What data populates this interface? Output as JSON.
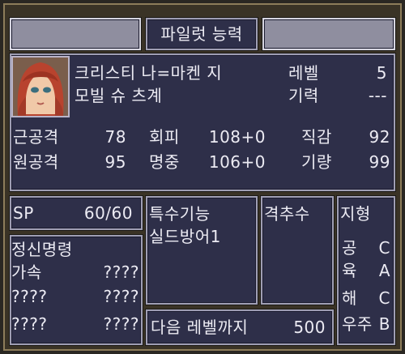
{
  "header": {
    "title": "파일럿 능력"
  },
  "pilot": {
    "name": "크리스티 나=마켄 지",
    "unit": "모빌 슈 츠계",
    "level_label": "레벨",
    "level_value": "5",
    "energy_label": "기력",
    "energy_value": "---"
  },
  "stats": {
    "melee_label": "근공격",
    "melee_value": "78",
    "ranged_label": "원공격",
    "ranged_value": "95",
    "evasion_label": "회피",
    "evasion_value": "108+0",
    "accuracy_label": "명중",
    "accuracy_value": "106+0",
    "intuition_label": "직감",
    "intuition_value": "92",
    "skill_label": "기량",
    "skill_value": "99"
  },
  "sp": {
    "label": "SP",
    "value": "60/60"
  },
  "spirit": {
    "title": "정신명령",
    "items": [
      "가속",
      "????",
      "????",
      "????",
      "????",
      "????"
    ]
  },
  "special": {
    "title": "특수기능",
    "item": "실드방어1"
  },
  "shootdown": {
    "title": "격추수"
  },
  "next_level": {
    "label": "다음 레벨까지",
    "value": "500"
  },
  "terrain": {
    "title": "지형",
    "rows": [
      {
        "label": "공",
        "grade": "C"
      },
      {
        "label": "육",
        "grade": "A"
      },
      {
        "label": "해",
        "grade": "C"
      },
      {
        "label": "우주",
        "grade": "B"
      }
    ]
  }
}
